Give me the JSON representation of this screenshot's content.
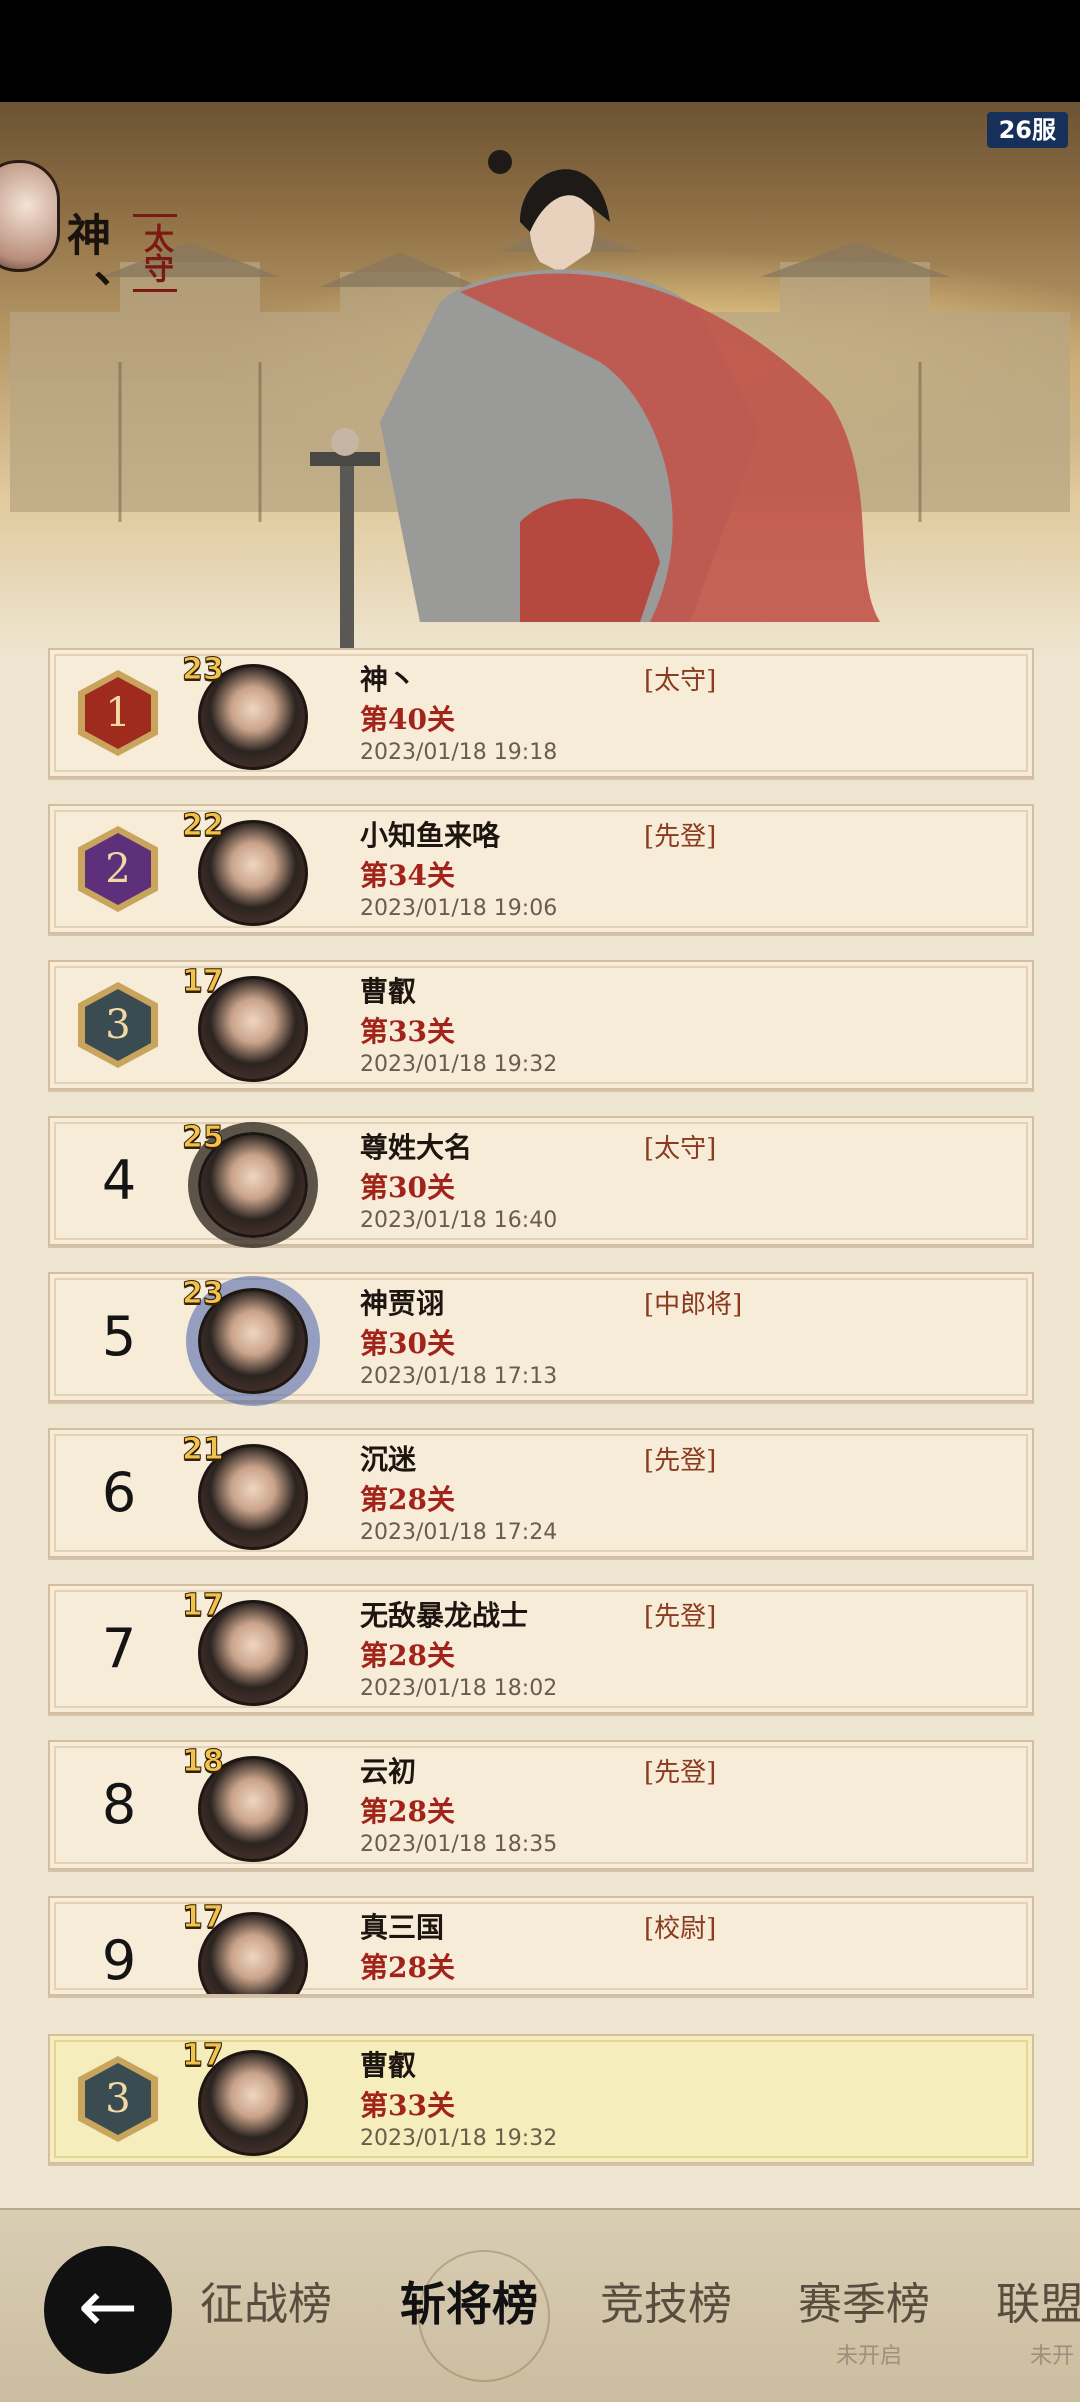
{
  "server_badge": "26服",
  "top_player": {
    "name": "神、",
    "title": "太守"
  },
  "rankings": [
    {
      "rank": "1",
      "level": "23",
      "name": "神丶",
      "stage": "第40关",
      "time": "2023/01/18  19:18",
      "title": "[太守]"
    },
    {
      "rank": "2",
      "level": "22",
      "name": "小知鱼来咯",
      "stage": "第34关",
      "time": "2023/01/18  19:06",
      "title": "[先登]"
    },
    {
      "rank": "3",
      "level": "17",
      "name": "曹叡",
      "stage": "第33关",
      "time": "2023/01/18  19:32",
      "title": ""
    },
    {
      "rank": "4",
      "level": "25",
      "name": "尊姓大名",
      "stage": "第30关",
      "time": "2023/01/18  16:40",
      "title": "[太守]"
    },
    {
      "rank": "5",
      "level": "23",
      "name": "神贾诩",
      "stage": "第30关",
      "time": "2023/01/18  17:13",
      "title": "[中郎将]"
    },
    {
      "rank": "6",
      "level": "21",
      "name": "沉迷",
      "stage": "第28关",
      "time": "2023/01/18  17:24",
      "title": "[先登]"
    },
    {
      "rank": "7",
      "level": "17",
      "name": "无敌暴龙战士",
      "stage": "第28关",
      "time": "2023/01/18  18:02",
      "title": "[先登]"
    },
    {
      "rank": "8",
      "level": "18",
      "name": "云初",
      "stage": "第28关",
      "time": "2023/01/18  18:35",
      "title": "[先登]"
    },
    {
      "rank": "9",
      "level": "17",
      "name": "真三国",
      "stage": "第28关",
      "time": "",
      "title": "[校尉]"
    }
  ],
  "my_rank": {
    "rank": "3",
    "level": "17",
    "name": "曹叡",
    "stage": "第33关",
    "time": "2023/01/18  19:32"
  },
  "bottom_nav": {
    "back_icon": "arrow-left-icon",
    "tabs": [
      {
        "label": "征战榜",
        "sub": ""
      },
      {
        "label": "斩将榜",
        "sub": ""
      },
      {
        "label": "竞技榜",
        "sub": ""
      },
      {
        "label": "赛季榜",
        "sub": "未开启"
      },
      {
        "label": "联盟",
        "sub": "未开"
      }
    ]
  },
  "colors": {
    "stage_red": "#a2231a",
    "level_gold": "#f3c24a",
    "self_row": "#f5edbb"
  }
}
